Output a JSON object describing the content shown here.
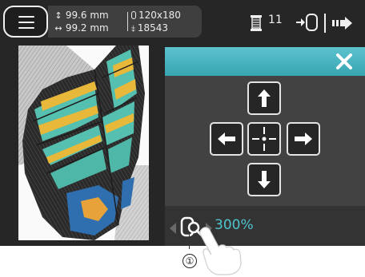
{
  "header": {
    "dimensions": {
      "height_value": "99.6 mm",
      "width_value": "99.2 mm",
      "hoop_value": "120x180",
      "stitch_count": "18543"
    },
    "color_count": "11",
    "icons": [
      "menu-icon",
      "thread-spool-icon",
      "hoop-select-icon",
      "next-arrow-icon"
    ]
  },
  "move_panel": {
    "accent_color": "#45b4c0",
    "icons": [
      "close-icon",
      "move-up-icon",
      "move-left-icon",
      "center-icon",
      "move-right-icon",
      "move-down-icon"
    ]
  },
  "zoom": {
    "value": "300%",
    "icon": "zoom-icon",
    "value_color": "#4fc4cf"
  },
  "callout": {
    "number": "①"
  }
}
